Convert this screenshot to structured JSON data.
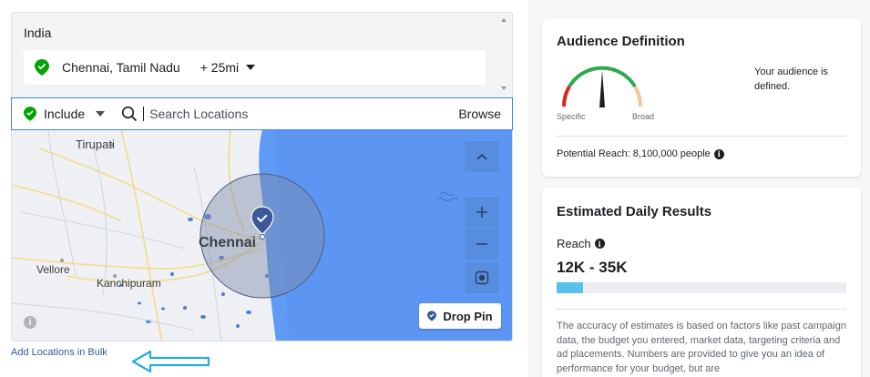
{
  "location_panel": {
    "country": "India",
    "selected_location": {
      "city": "Chennai, Tamil Nadu",
      "radius": "+ 25mi"
    }
  },
  "search_bar": {
    "include_label": "Include",
    "placeholder": "Search Locations",
    "browse_label": "Browse"
  },
  "map": {
    "labels": {
      "tirupati": "Tirupati",
      "chennai": "Chennai",
      "vellore": "Vellore",
      "kanchipuram": "Kanchipuram"
    },
    "drop_pin_label": "Drop Pin"
  },
  "bulk_link_label": "Add Locations in Bulk",
  "audience_definition": {
    "title": "Audience Definition",
    "gauge_left_label": "Specific",
    "gauge_right_label": "Broad",
    "message": "Your audience is defined.",
    "potential_reach": "Potential Reach: 8,100,000 people"
  },
  "estimated_daily_results": {
    "title": "Estimated Daily Results",
    "reach_label": "Reach",
    "reach_range": "12K - 35K",
    "reach_bar_fraction": 0.09,
    "note": "The accuracy of estimates is based on factors like past campaign data, the budget you entered, market data, targeting criteria and ad placements. Numbers are provided to give you an idea of performance for your budget, but are"
  },
  "colors": {
    "accent_blue": "#4080ff",
    "success_green": "#00a400",
    "map_sea": "#5f9af5",
    "reach_bar": "#57c0ec",
    "arrow_blue": "#29a8e0"
  }
}
